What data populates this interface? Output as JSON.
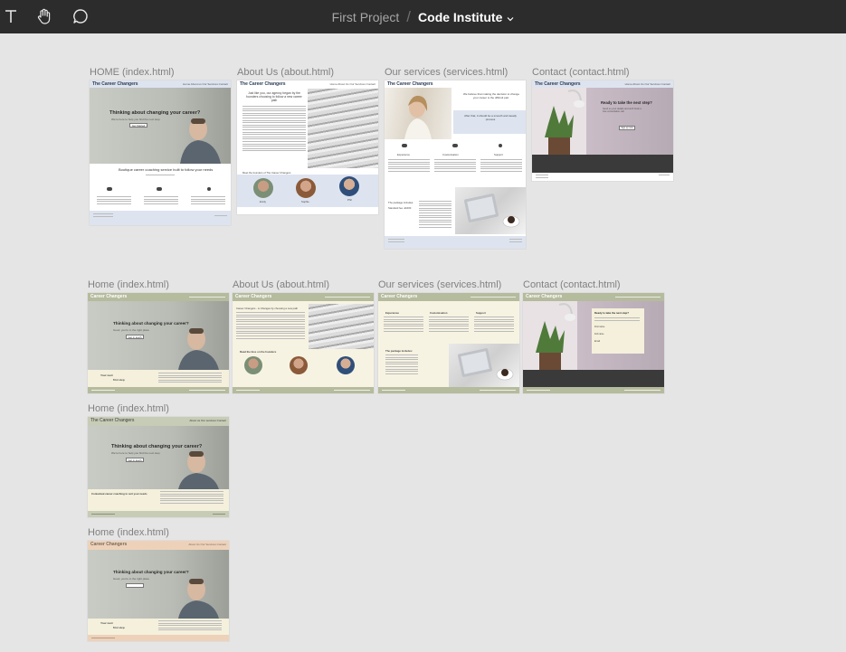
{
  "toolbar": {
    "tools": [
      "text-tool-icon",
      "hand-tool-icon",
      "comment-tool-icon"
    ],
    "project": "First Project",
    "separator": "/",
    "file": "Code Institute"
  },
  "colors": {
    "toolbar_bg": "#2c2c2c",
    "canvas_bg": "#e5e5e5",
    "wire_blue": "#dde4ef",
    "olive": "#b5bb9d",
    "cream": "#f4f0dc",
    "peach": "#edd2b9",
    "sage": "#c7ccb6"
  },
  "frames": {
    "r1_home": {
      "label": "HOME (index.html)",
      "brand": "The Career Changers",
      "nav": "Home  About us  Our Services  Contact",
      "hero_title": "Thinking about changing your career?",
      "hero_sub": "We're here to help you find the next step",
      "cta": "Get Started",
      "section_title": "Boutique career coaching service built to follow your needs"
    },
    "r1_about": {
      "label": "About Us (about.html)",
      "brand": "The Career Changers",
      "nav": "Home  About Us  Our Services  Contact",
      "heading": "Just like you, our agency began by the founders choosing to follow a new career path",
      "founders_title": "Meet the founders of The Career Changers",
      "founders": [
        "Emily",
        "Sophie",
        "Phil"
      ]
    },
    "r1_services": {
      "label": "Our services (services.html)",
      "brand": "The Career Changers",
      "quote": "We believe that making the decision to change your career is the difficult part.",
      "quote2": "After that, it should be a smooth and steady process",
      "features": [
        "Experience",
        "Customisation",
        "Support"
      ],
      "package": "The package includes:",
      "price": "Standard fee: £1000"
    },
    "r1_contact": {
      "label": "Contact (contact.html)",
      "brand": "The Career Changers",
      "nav": "Home  About Us  Our Services  Contact",
      "title": "Ready to take the next step?",
      "sub": "Send us your details and we'll book a free consultation call",
      "button": "Sign up now"
    },
    "r2_home": {
      "label": "Home (index.html)",
      "brand": "Career Changers",
      "hero_title": "Thinking about changing your career?",
      "hero_sub": "Good, you're in the right place",
      "cta": "Get in touch",
      "left1": "Your next",
      "left2": "first step"
    },
    "r2_about": {
      "label": "About Us (about.html)",
      "brand": "Career Changers",
      "heading": "Career Changers - is Changes by choosing a new path",
      "founders_title": "Read the bios on the founders"
    },
    "r2_services": {
      "label": "Our services (services.html)",
      "brand": "Career Changers",
      "features": [
        "Experience",
        "Customisation",
        "Support"
      ],
      "package": "The package includes:"
    },
    "r2_contact": {
      "label": "Contact (contact.html)",
      "brand": "Career Changers",
      "title": "Ready to take the next step?",
      "fields": [
        "First name",
        "Full name",
        "Email"
      ]
    },
    "r3_home": {
      "label": "Home (index.html)",
      "brand": "The Career Changers",
      "nav": "About us   Our services   Contact",
      "hero_title": "Thinking about changing your career?",
      "hero_sub": "We're here to help you find the next step",
      "cta": "Get in touch",
      "section_title": "Contextual career coaching to suit your needs"
    },
    "r4_home": {
      "label": "Home (index.html)",
      "brand": "Career Changers",
      "nav": "About Us   Our Services   Contact",
      "hero_title": "Thinking about changing your career?",
      "hero_sub": "Good, you're in the right place",
      "left1": "Your next",
      "left2": "first step"
    }
  }
}
